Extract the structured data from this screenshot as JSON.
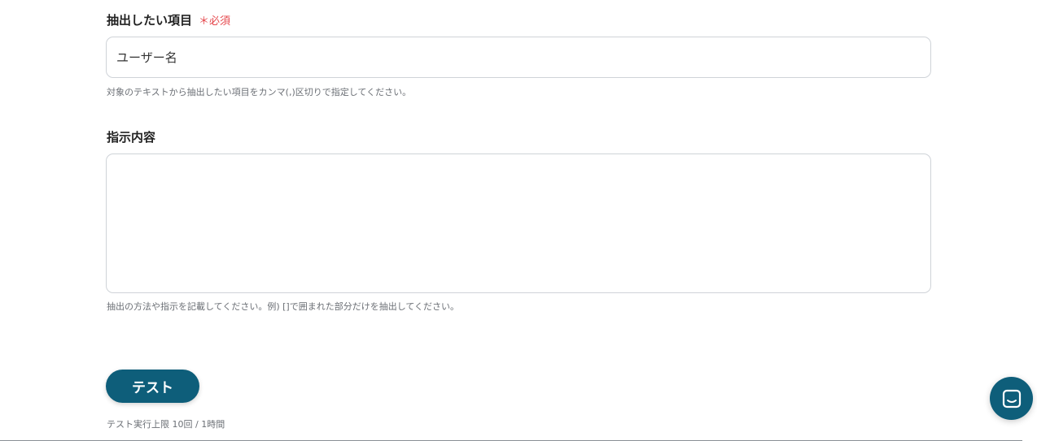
{
  "fields": {
    "extract_items": {
      "label": "抽出したい項目",
      "required_label": "＊必須",
      "value": "ユーザー名",
      "help": "対象のテキストから抽出したい項目をカンマ(,)区切りで指定してください。"
    },
    "instructions": {
      "label": "指示内容",
      "value": "",
      "help": "抽出の方法や指示を記載してください。例) []で囲まれた部分だけを抽出してください。"
    }
  },
  "test": {
    "button_label": "テスト",
    "limit_text": "テスト実行上限 10回 / 1時間"
  },
  "chat_launcher": {
    "icon": "chat-icon"
  },
  "colors": {
    "accent": "#0e5e7a",
    "required": "#e5484d"
  }
}
